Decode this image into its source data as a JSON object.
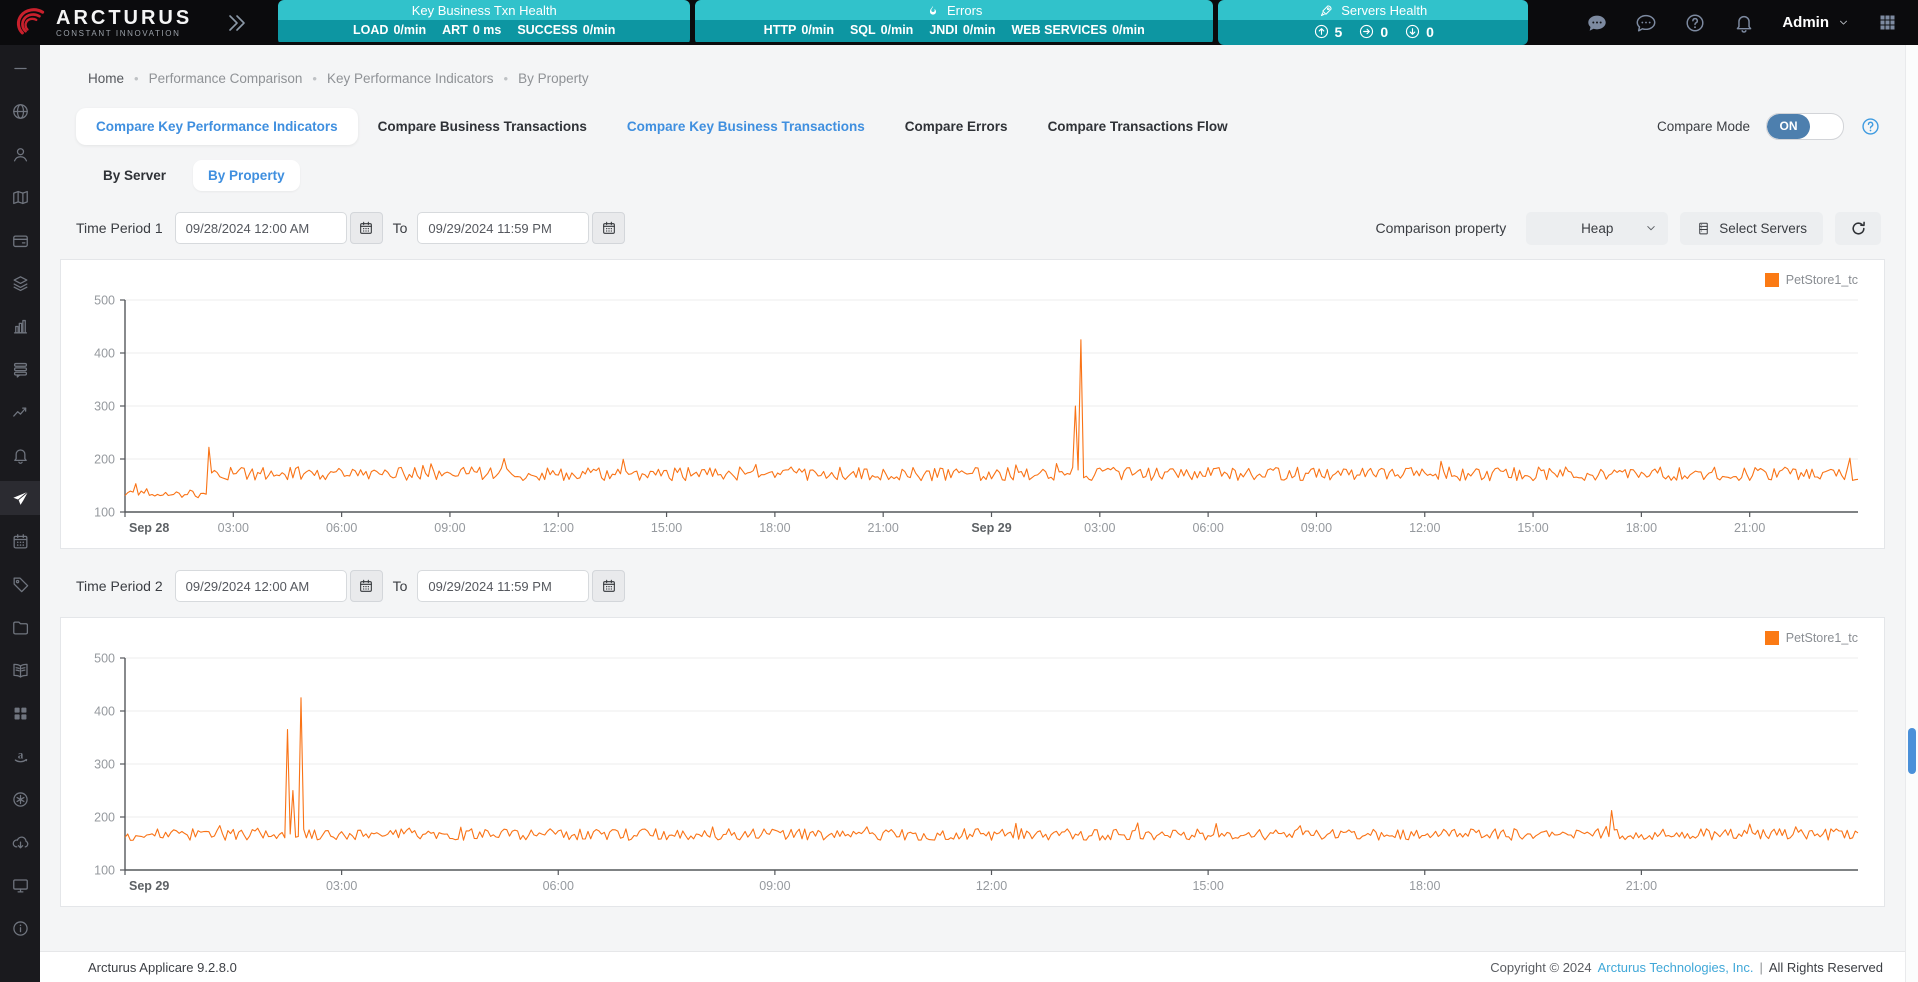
{
  "header": {
    "brand": {
      "name": "ARCTURUS",
      "tagline": "CONSTANT INNOVATION"
    },
    "widgets": [
      {
        "title": "Key Business Txn Health",
        "metrics": [
          {
            "label": "LOAD",
            "value": "0/min"
          },
          {
            "label": "ART",
            "value": "0 ms"
          },
          {
            "label": "SUCCESS",
            "value": "0/min"
          }
        ]
      },
      {
        "title": "Errors",
        "icon": "flame",
        "metrics": [
          {
            "label": "HTTP",
            "value": "0/min"
          },
          {
            "label": "SQL",
            "value": "0/min"
          },
          {
            "label": "JNDI",
            "value": "0/min"
          },
          {
            "label": "WEB SERVICES",
            "value": "0/min"
          }
        ]
      },
      {
        "title": "Servers Health",
        "icon": "rocket",
        "counters": [
          {
            "icon": "arrow-up-circle",
            "value": "5"
          },
          {
            "icon": "arrow-right-circle",
            "value": "0"
          },
          {
            "icon": "arrow-down-circle",
            "value": "0"
          }
        ]
      }
    ],
    "actions": [
      {
        "icon": "chat-filled"
      },
      {
        "icon": "chat-outline"
      },
      {
        "icon": "help-circle"
      },
      {
        "icon": "bell"
      }
    ],
    "user": {
      "name": "Admin"
    }
  },
  "breadcrumb": {
    "items": [
      "Home",
      "Performance Comparison",
      "Key Performance Indicators",
      "By Property"
    ]
  },
  "tabs": [
    {
      "label": "Compare Key Performance Indicators",
      "active": true
    },
    {
      "label": "Compare Business Transactions"
    },
    {
      "label": "Compare Key Business Transactions",
      "highlighted": true
    },
    {
      "label": "Compare Errors"
    },
    {
      "label": "Compare Transactions Flow"
    }
  ],
  "compare_mode": {
    "label": "Compare Mode",
    "state": "ON"
  },
  "subtabs": [
    {
      "label": "By Server"
    },
    {
      "label": "By Property",
      "active": true
    }
  ],
  "period1": {
    "label": "Time Period 1",
    "from": "09/28/2024 12:00 AM",
    "to_label": "To",
    "to": "09/29/2024 11:59 PM"
  },
  "comparison": {
    "label": "Comparison property",
    "selected": "Heap",
    "select_servers_label": "Select Servers"
  },
  "period2": {
    "label": "Time Period 2",
    "from": "09/29/2024 12:00 AM",
    "to_label": "To",
    "to": "09/29/2024 11:59 PM"
  },
  "chart_data": [
    {
      "type": "line",
      "legend": "PetStore1_tc",
      "color": "#f97316",
      "x_range_hours": 48,
      "y_min": 100,
      "y_max": 500,
      "y_ticks": [
        100,
        200,
        300,
        400,
        500
      ],
      "grid": true,
      "legend_position": "top-right",
      "x_ticks": [
        {
          "hour": 0,
          "label": "Sep 28",
          "emph": true
        },
        {
          "hour": 3,
          "label": "03:00"
        },
        {
          "hour": 6,
          "label": "06:00"
        },
        {
          "hour": 9,
          "label": "09:00"
        },
        {
          "hour": 12,
          "label": "12:00"
        },
        {
          "hour": 15,
          "label": "15:00"
        },
        {
          "hour": 18,
          "label": "18:00"
        },
        {
          "hour": 21,
          "label": "21:00"
        },
        {
          "hour": 24,
          "label": "Sep 29",
          "emph": true
        },
        {
          "hour": 27,
          "label": "03:00"
        },
        {
          "hour": 30,
          "label": "06:00"
        },
        {
          "hour": 33,
          "label": "09:00"
        },
        {
          "hour": 36,
          "label": "12:00"
        },
        {
          "hour": 39,
          "label": "15:00"
        },
        {
          "hour": 42,
          "label": "18:00"
        },
        {
          "hour": 45,
          "label": "21:00"
        }
      ],
      "series": [
        {
          "name": "PetStore1_tc",
          "segments": [
            {
              "from_hour": 0,
              "to_hour": 2.3,
              "baseline": 135,
              "noise": 9
            },
            {
              "from_hour": 2.3,
              "to_hour": 48,
              "baseline": 172,
              "noise": 13
            }
          ],
          "spikes": [
            {
              "hour": 2.33,
              "value": 222
            },
            {
              "hour": 26.35,
              "value": 300
            },
            {
              "hour": 26.45,
              "value": 425
            }
          ],
          "seed": 12
        }
      ]
    },
    {
      "type": "line",
      "legend": "PetStore1_tc",
      "color": "#f97316",
      "x_range_hours": 24,
      "y_min": 100,
      "y_max": 500,
      "y_ticks": [
        100,
        200,
        300,
        400,
        500
      ],
      "grid": true,
      "legend_position": "top-right",
      "x_ticks": [
        {
          "hour": 0,
          "label": "Sep 29",
          "emph": true
        },
        {
          "hour": 3,
          "label": "03:00"
        },
        {
          "hour": 6,
          "label": "06:00"
        },
        {
          "hour": 9,
          "label": "09:00"
        },
        {
          "hour": 12,
          "label": "12:00"
        },
        {
          "hour": 15,
          "label": "15:00"
        },
        {
          "hour": 18,
          "label": "18:00"
        },
        {
          "hour": 21,
          "label": "21:00"
        }
      ],
      "series": [
        {
          "name": "PetStore1_tc",
          "segments": [
            {
              "from_hour": 0,
              "to_hour": 24,
              "baseline": 167,
              "noise": 11
            }
          ],
          "spikes": [
            {
              "hour": 2.25,
              "value": 365
            },
            {
              "hour": 2.33,
              "value": 250
            },
            {
              "hour": 2.45,
              "value": 425
            },
            {
              "hour": 20.6,
              "value": 212
            }
          ],
          "seed": 99
        }
      ]
    }
  ],
  "sidebar": {
    "items": [
      {
        "icon": "menu"
      },
      {
        "icon": "globe"
      },
      {
        "icon": "user"
      },
      {
        "icon": "map"
      },
      {
        "icon": "wallet"
      },
      {
        "icon": "layers"
      },
      {
        "icon": "bar-chart"
      },
      {
        "icon": "database"
      },
      {
        "icon": "trend-line"
      },
      {
        "icon": "bell"
      },
      {
        "icon": "paper-plane",
        "active": true
      },
      {
        "icon": "calendar"
      },
      {
        "icon": "tag"
      },
      {
        "icon": "folder"
      },
      {
        "icon": "book"
      },
      {
        "icon": "grid"
      },
      {
        "icon": "amazon"
      },
      {
        "icon": "gear"
      },
      {
        "icon": "cloud-download"
      },
      {
        "icon": "monitor"
      },
      {
        "icon": "info"
      }
    ]
  },
  "footer": {
    "product": "Arcturus Applicare 9.2.8.0",
    "copyright": "Copyright © 2024",
    "company": "Arcturus Technologies, Inc.",
    "divider": "|",
    "rights": "All Rights Reserved"
  },
  "colors": {
    "accent_teal": "#0d96a2",
    "series_orange": "#f97316",
    "link_blue": "#3f8fdf",
    "toggle_blue": "#4d7fae"
  }
}
